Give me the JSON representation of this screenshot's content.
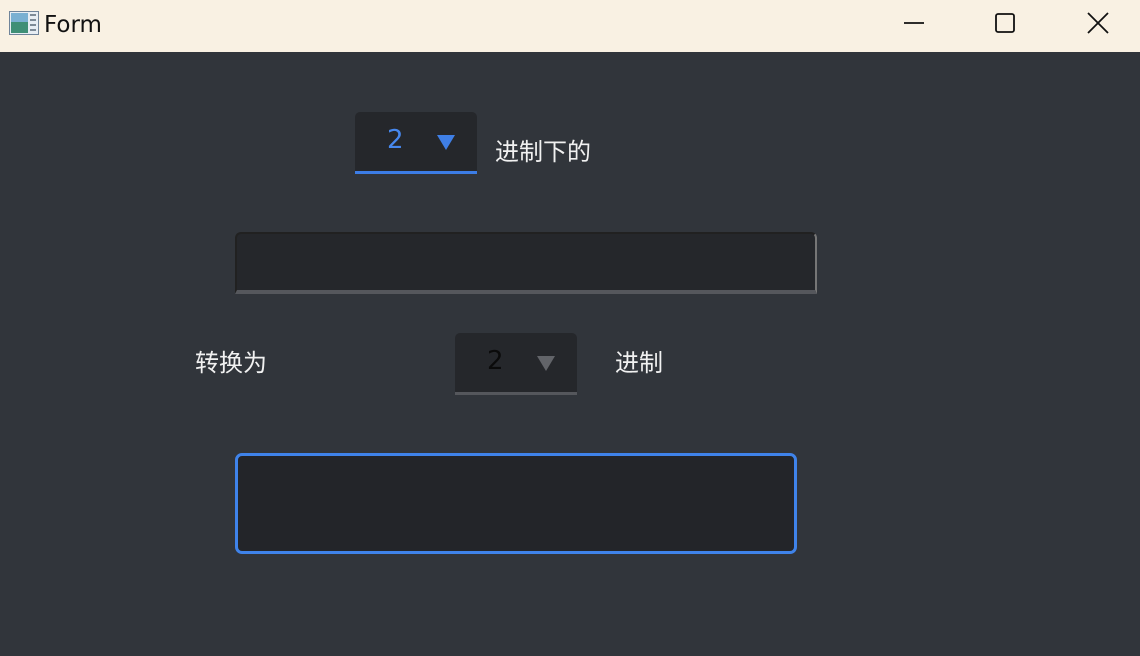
{
  "window": {
    "title": "Form",
    "icon": "app-form-icon",
    "controls": [
      "minimize-icon",
      "maximize-icon",
      "close-icon"
    ]
  },
  "source_base": {
    "selected": "2",
    "suffix_label": "进制下的"
  },
  "input_number": {
    "value": ""
  },
  "convert_to_label": "转换为",
  "target_base": {
    "selected": "2",
    "suffix_label": "进制"
  },
  "result": {
    "value": ""
  },
  "colors": {
    "titlebar": "#f9f1e3",
    "background": "#31353b",
    "field": "#25272b",
    "accent": "#3c7de6",
    "inactive_underline": "#55575c",
    "text": "#f1f1f1"
  }
}
